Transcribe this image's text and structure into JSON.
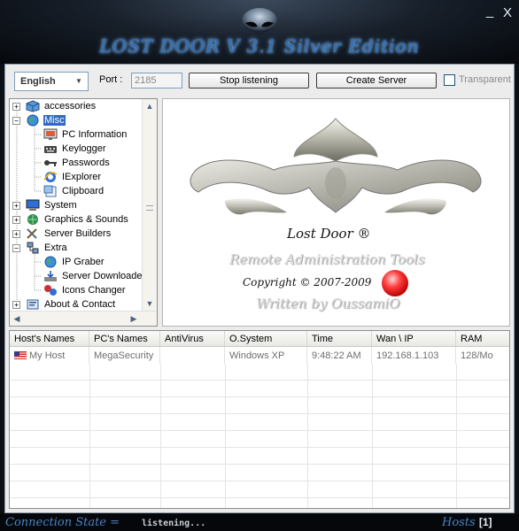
{
  "window": {
    "title": "LOST DOOR V 3.1 Silver Edition",
    "minimize_label": "_",
    "close_label": "X"
  },
  "toolbar": {
    "language": "English",
    "port_label": "Port :",
    "port_value": "2185",
    "stop_button": "Stop listening",
    "create_button": "Create Server",
    "transparent_label": "Transparent",
    "transparent_checked": false
  },
  "tree": {
    "items": [
      {
        "label": "accessories",
        "expander": "+",
        "icon": "cube-icon",
        "level": 0
      },
      {
        "label": "Misc",
        "expander": "−",
        "icon": "globe-icon",
        "level": 0,
        "selected": true
      },
      {
        "label": "PC Information",
        "icon": "monitor-icon",
        "level": 1
      },
      {
        "label": "Keylogger",
        "icon": "keyboard-icon",
        "level": 1
      },
      {
        "label": "Passwords",
        "icon": "key-icon",
        "level": 1
      },
      {
        "label": "IExplorer",
        "icon": "explorer-icon",
        "level": 1
      },
      {
        "label": "Clipboard",
        "icon": "clipboard-icon",
        "level": 1
      },
      {
        "label": "System",
        "expander": "+",
        "icon": "computer-icon",
        "level": 0
      },
      {
        "label": "Graphics & Sounds",
        "expander": "+",
        "icon": "graphics-icon",
        "level": 0
      },
      {
        "label": "Server Builders",
        "expander": "+",
        "icon": "tools-icon",
        "level": 0
      },
      {
        "label": "Extra",
        "expander": "−",
        "icon": "network-icon",
        "level": 0
      },
      {
        "label": "IP Graber",
        "icon": "globe-icon",
        "level": 1
      },
      {
        "label": "Server Downloader",
        "icon": "download-icon",
        "level": 1
      },
      {
        "label": "Icons Changer",
        "icon": "icons-icon",
        "level": 1
      },
      {
        "label": "About & Contact",
        "expander": "+",
        "icon": "about-icon",
        "level": 0
      }
    ]
  },
  "splash": {
    "title": "Lost Door ®",
    "subtitle": "Remote Administration Tools",
    "copyright": "Copyright © 2007-2009",
    "author": "Written by OussamiO"
  },
  "grid": {
    "columns": [
      "Host's Names",
      "PC's Names",
      "AntiVirus",
      "O.System",
      "Time",
      "Wan \\ IP",
      "RAM"
    ],
    "rows": [
      [
        "My Host",
        "MegaSecurity",
        "",
        "Windows XP",
        "9:48:22 AM",
        "192.168.1.103",
        "128/Mo"
      ]
    ]
  },
  "status": {
    "state_label": "Connection State =",
    "state_value": "listening...",
    "hosts_label": "Hosts",
    "hosts_count": "[1]"
  },
  "colors": {
    "accent": "#3169c6",
    "title_glow": "#2f6fb5",
    "status_text": "#4a86c8"
  }
}
